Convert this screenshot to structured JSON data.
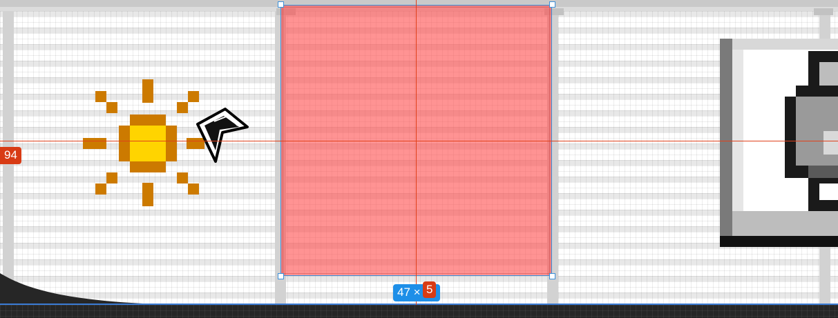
{
  "canvas": {
    "guide_y_value": "94",
    "selection_size": {
      "width_label": "47 × ",
      "height_label": "5"
    }
  },
  "icons": {
    "sun": "sun-icon",
    "cursor": "arrow-cursor-icon",
    "monitor": "monitor-icon"
  },
  "colors": {
    "selection_fill": "#ff5050",
    "selection_border": "#3a8fd9",
    "guide": "#e0401a",
    "badge_red": "#d83b14",
    "badge_blue": "#1e8fe8",
    "sun_core": "#ffd400",
    "sun_rays": "#cc7a00"
  }
}
